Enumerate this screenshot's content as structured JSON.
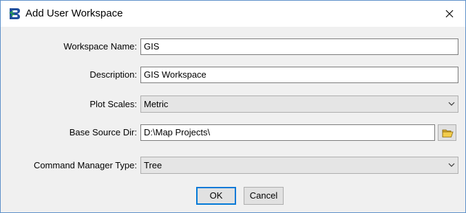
{
  "window": {
    "title": "Add User Workspace",
    "app_icon": "bentley-b-logo-icon",
    "close_icon": "close-icon"
  },
  "form": {
    "workspace_name": {
      "label": "Workspace Name:",
      "value": "GIS"
    },
    "description": {
      "label": "Description:",
      "value": "GIS Workspace"
    },
    "plot_scales": {
      "label": "Plot Scales:",
      "selected": "Metric"
    },
    "base_source_dir": {
      "label": "Base Source Dir:",
      "value": "D:\\Map Projects\\",
      "browse_icon": "open-folder-icon"
    },
    "command_manager_type": {
      "label": "Command Manager Type:",
      "selected": "Tree"
    }
  },
  "buttons": {
    "ok_label": "OK",
    "cancel_label": "Cancel"
  },
  "colors": {
    "accent": "#0078d7",
    "dialog_background": "#f0f0f0",
    "window_border": "#5b8fc9"
  }
}
